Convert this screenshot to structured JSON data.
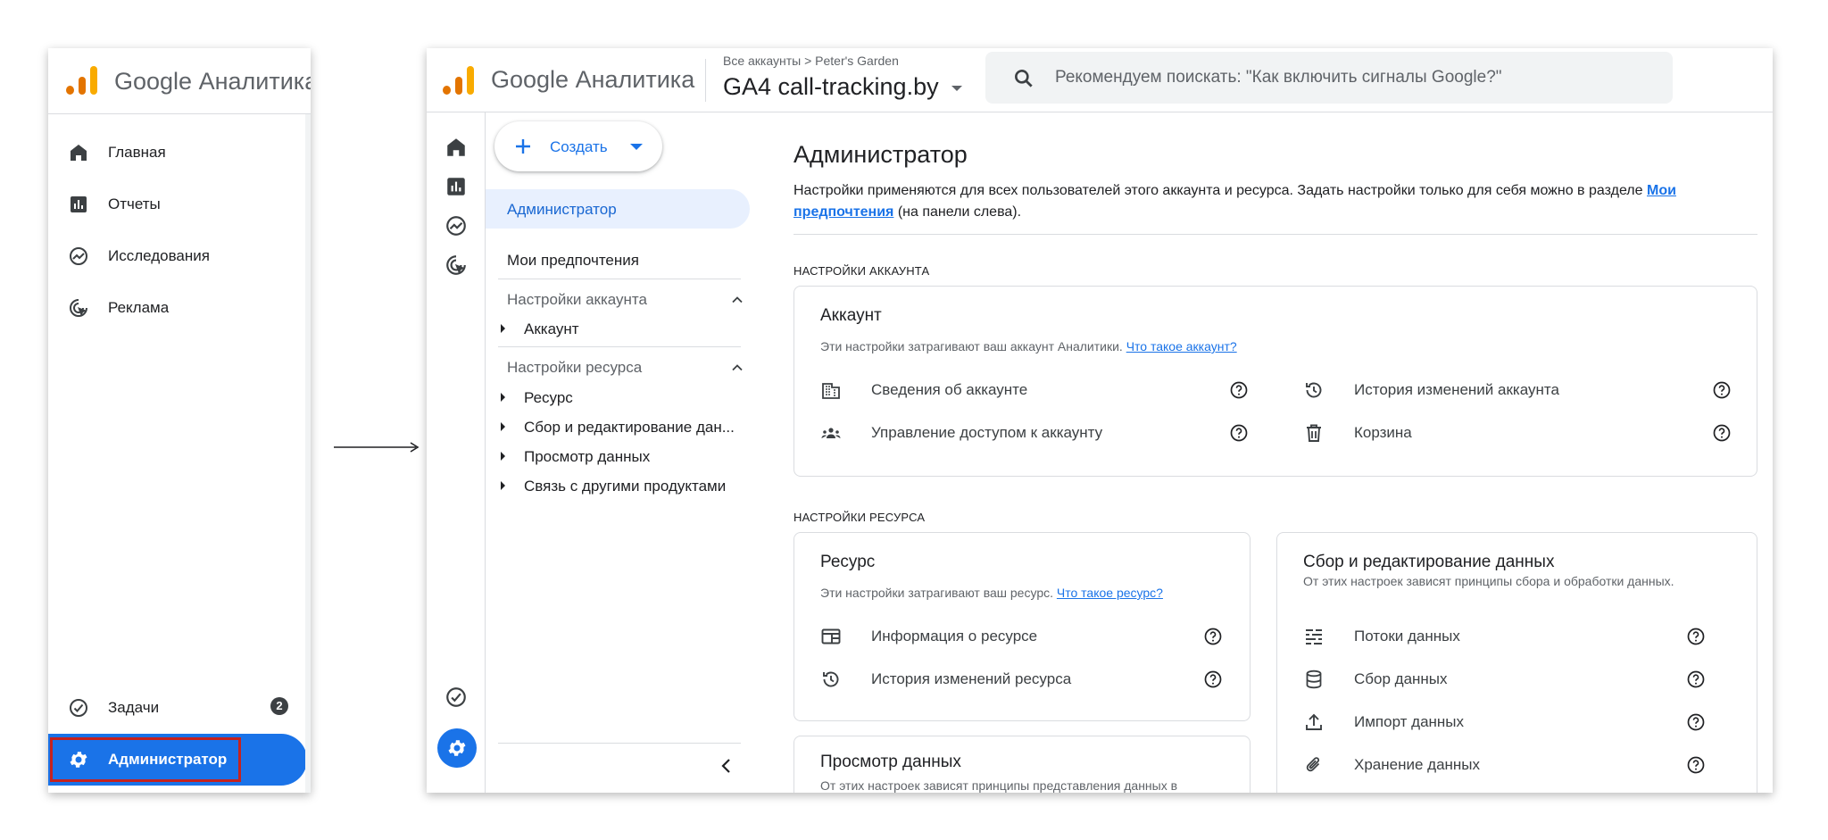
{
  "brand": {
    "name": "Google Аналитика",
    "logo_colors": [
      "#f9ab00",
      "#e37400",
      "#e37400"
    ]
  },
  "left_panel": {
    "nav_items": [
      {
        "label": "Главная",
        "icon": "home-icon"
      },
      {
        "label": "Отчеты",
        "icon": "reports-icon"
      },
      {
        "label": "Исследования",
        "icon": "explore-icon"
      },
      {
        "label": "Реклама",
        "icon": "advertising-icon"
      }
    ],
    "tasks": {
      "label": "Задачи",
      "icon": "check-circle-icon",
      "badge": "2"
    },
    "admin": {
      "label": "Администратор",
      "icon": "gear-icon"
    }
  },
  "topbar": {
    "breadcrumb": "Все аккаунты > Peter's Garden",
    "property": "GA4 call-tracking.by",
    "search_placeholder": "Рекомендуем поискать: \"Как включить сигналы Google?\""
  },
  "nav": {
    "create_label": "Создать",
    "selected": "Администратор",
    "preferences": "Мои предпочтения",
    "account_section": "Настройки аккаунта",
    "account_items": [
      "Аккаунт"
    ],
    "property_section": "Настройки ресурса",
    "property_items": [
      "Ресурс",
      "Сбор и редактирование дан...",
      "Просмотр данных",
      "Связь с другими продуктами"
    ]
  },
  "content": {
    "title": "Администратор",
    "intro_text": "Настройки применяются для всех пользователей этого аккаунта и ресурса. Задать настройки только для себя можно в разделе",
    "intro_link": "Мои предпочтения",
    "intro_suffix": "(на панели слева).",
    "account_settings_label": "НАСТРОЙКИ АККАУНТА",
    "property_settings_label": "НАСТРОЙКИ РЕСУРСА",
    "account_card": {
      "title": "Аккаунт",
      "desc": "Эти настройки затрагивают ваш аккаунт Аналитики.",
      "link": "Что такое аккаунт?",
      "items": [
        {
          "label": "Сведения об аккаунте",
          "icon": "building-icon"
        },
        {
          "label": "История изменений аккаунта",
          "icon": "history-icon"
        },
        {
          "label": "Управление доступом к аккаунту",
          "icon": "people-icon"
        },
        {
          "label": "Корзина",
          "icon": "trash-icon"
        }
      ]
    },
    "property_card": {
      "title": "Ресурс",
      "desc": "Эти настройки затрагивают ваш ресурс.",
      "link": "Что такое ресурс?",
      "items": [
        {
          "label": "Информация о ресурсе",
          "icon": "web-icon"
        },
        {
          "label": "История изменений ресурса",
          "icon": "history-icon"
        }
      ]
    },
    "data_collection_card": {
      "title": "Сбор и редактирование данных",
      "desc": "От этих настроек зависят принципы сбора и обработки данных.",
      "items": [
        {
          "label": "Потоки данных",
          "icon": "streams-icon"
        },
        {
          "label": "Сбор данных",
          "icon": "database-icon"
        },
        {
          "label": "Импорт данных",
          "icon": "upload-icon"
        },
        {
          "label": "Хранение данных",
          "icon": "paperclip-icon"
        }
      ]
    },
    "data_display_card": {
      "title": "Просмотр данных",
      "desc": "От этих настроек зависят принципы представления данных в"
    }
  }
}
